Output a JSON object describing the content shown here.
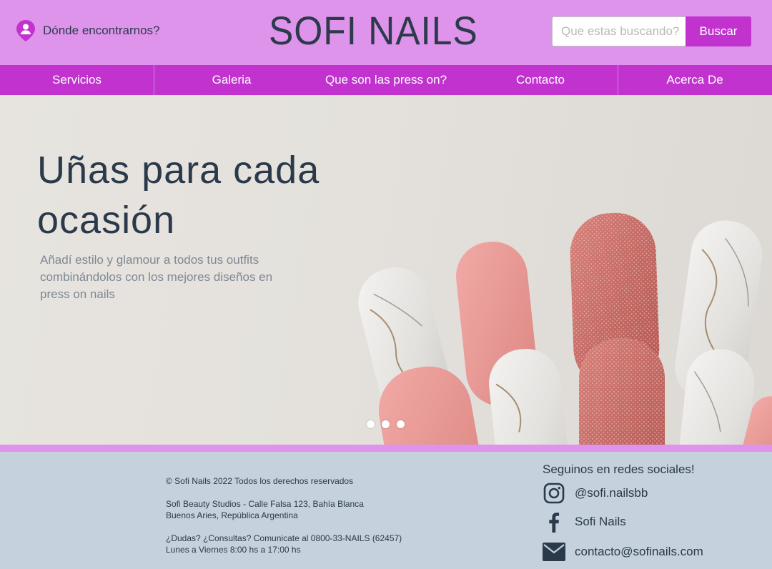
{
  "header": {
    "location_label": "Dónde encontrarnos?",
    "brand": "SOFI NAILS",
    "search_placeholder": "Que estas buscando?",
    "search_button": "Buscar",
    "accent_color": "#c132cf",
    "header_color": "#dd94ea"
  },
  "nav": {
    "items": [
      "Servicios",
      "Galeria",
      "Que son las press on?",
      "Contacto",
      "Acerca De"
    ]
  },
  "hero": {
    "title_line1": "Uñas para cada",
    "title_line2": "ocasión",
    "subtitle": "Añadí estilo y glamour a todos tus outfits combinándolos con los mejores diseños en press on nails",
    "slide_count": 3
  },
  "footer": {
    "copyright": "© Sofi Nails 2022 Todos los derechos reservados",
    "address_line1": "Sofi Beauty Studios - Calle Falsa 123, Bahía Blanca",
    "address_line2": "Buenos Aries, República Argentina",
    "contact_line1": "¿Dudas? ¿Consultas? Comunicate al 0800-33-NAILS (62457)",
    "contact_line2": "Lunes a Viernes 8:00 hs a 17:00 hs",
    "social_title": "Seguinos en redes sociales!",
    "instagram": "@sofi.nailsbb",
    "facebook": "Sofi Nails",
    "email": "contacto@sofinails.com",
    "icons": [
      "instagram-icon",
      "facebook-icon",
      "mail-icon"
    ]
  }
}
